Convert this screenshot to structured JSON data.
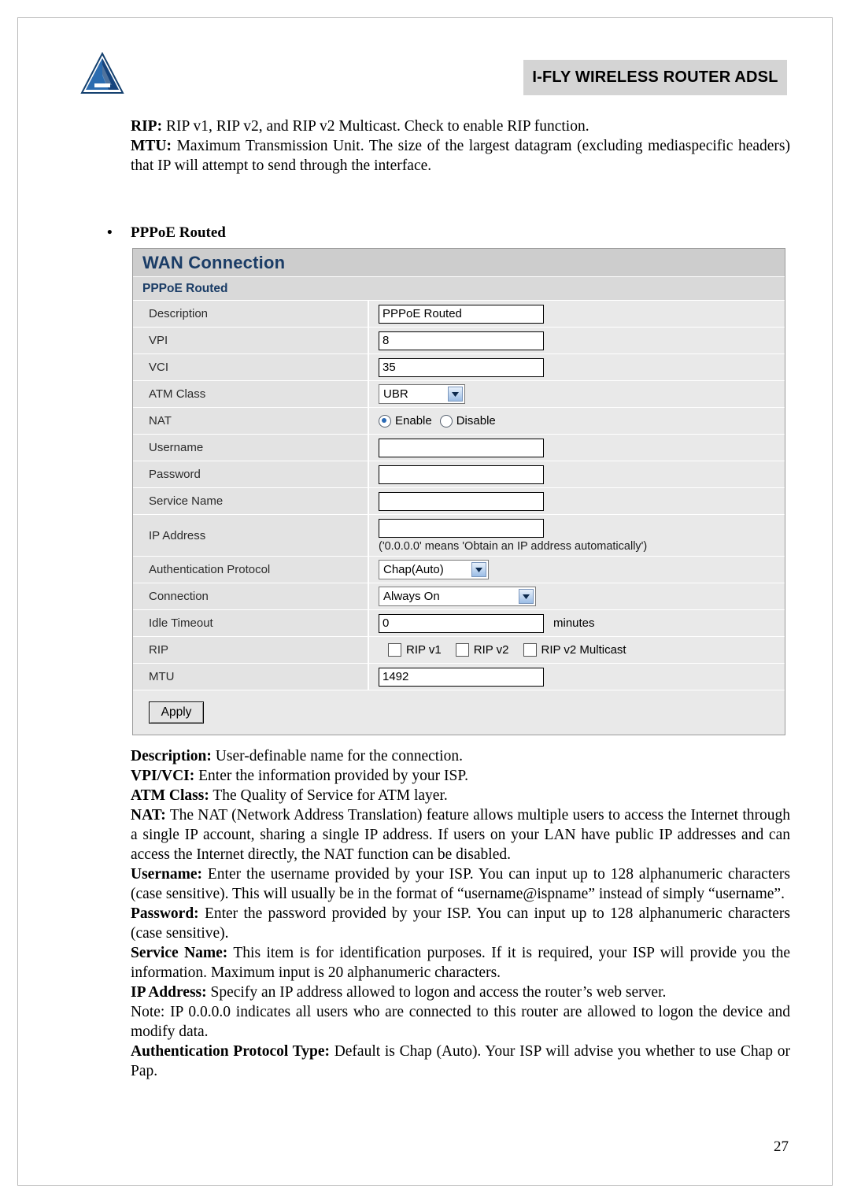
{
  "header": {
    "title": "I-FLY WIRELESS ROUTER ADSL",
    "logo_name": "atlantis-land-logo"
  },
  "intro": {
    "rip_label": "RIP:",
    "rip_text": " RIP v1, RIP v2, and RIP v2 Multicast. Check to enable RIP function.",
    "mtu_label": "MTU:",
    "mtu_text": " Maximum Transmission Unit. The size of the largest datagram (excluding mediaspecific headers) that IP will attempt to send through the interface."
  },
  "bullet": {
    "dot": "•",
    "label": "PPPoE Routed"
  },
  "panel": {
    "title": "WAN Connection",
    "subtitle": "PPPoE Routed",
    "rows": {
      "description": {
        "label": "Description",
        "value": "PPPoE Routed"
      },
      "vpi": {
        "label": "VPI",
        "value": "8"
      },
      "vci": {
        "label": "VCI",
        "value": "35"
      },
      "atm_class": {
        "label": "ATM Class",
        "value": "UBR"
      },
      "nat": {
        "label": "NAT",
        "enable_label": "Enable",
        "disable_label": "Disable",
        "selected": "Enable"
      },
      "username": {
        "label": "Username",
        "value": ""
      },
      "password": {
        "label": "Password",
        "value": ""
      },
      "service_name": {
        "label": "Service Name",
        "value": ""
      },
      "ip_address": {
        "label": "IP Address",
        "value": "",
        "hint": "('0.0.0.0' means 'Obtain an IP address automatically')"
      },
      "auth_protocol": {
        "label": "Authentication Protocol",
        "value": "Chap(Auto)"
      },
      "connection": {
        "label": "Connection",
        "value": "Always On"
      },
      "idle_timeout": {
        "label": "Idle Timeout",
        "value": "0",
        "unit": "minutes"
      },
      "rip": {
        "label": "RIP",
        "options": [
          "RIP v1",
          "RIP v2",
          "RIP v2 Multicast"
        ]
      },
      "mtu": {
        "label": "MTU",
        "value": "1492"
      }
    },
    "apply_label": "Apply"
  },
  "descriptions": [
    {
      "term": "Description:",
      "text": " User-definable name for the connection."
    },
    {
      "term": "VPI/VCI:",
      "text": " Enter the information provided by your ISP."
    },
    {
      "term": "ATM Class:",
      "text": " The Quality of Service for ATM layer."
    },
    {
      "term": "NAT:",
      "text": " The NAT (Network Address Translation) feature allows multiple users to access the Internet through a single IP account, sharing a single IP address. If users on your LAN have public IP addresses and can access the Internet directly, the NAT function can be disabled."
    },
    {
      "term": "Username:",
      "text": " Enter the username provided by your ISP. You can input up to 128 alphanumeric characters (case sensitive). This will usually be in the format of “username@ispname” instead of simply “username”."
    },
    {
      "term": "Password:",
      "text": " Enter the password provided by your ISP. You can input up to 128 alphanumeric characters (case sensitive)."
    },
    {
      "term": "Service Name:",
      "text": " This item is for identification purposes. If it is required, your ISP will provide you the information. Maximum input is 20 alphanumeric characters."
    },
    {
      "term": "IP Address:",
      "text": " Specify an IP address allowed to logon and access the router’s web server."
    },
    {
      "term": "Note:",
      "text": " IP 0.0.0.0 indicates all users who are connected to this router are allowed to logon the device and modify data.",
      "plain": true
    },
    {
      "term": "Authentication Protocol Type:",
      "text": " Default is Chap (Auto). Your ISP will advise you whether to use Chap or Pap."
    }
  ],
  "page_number": "27"
}
